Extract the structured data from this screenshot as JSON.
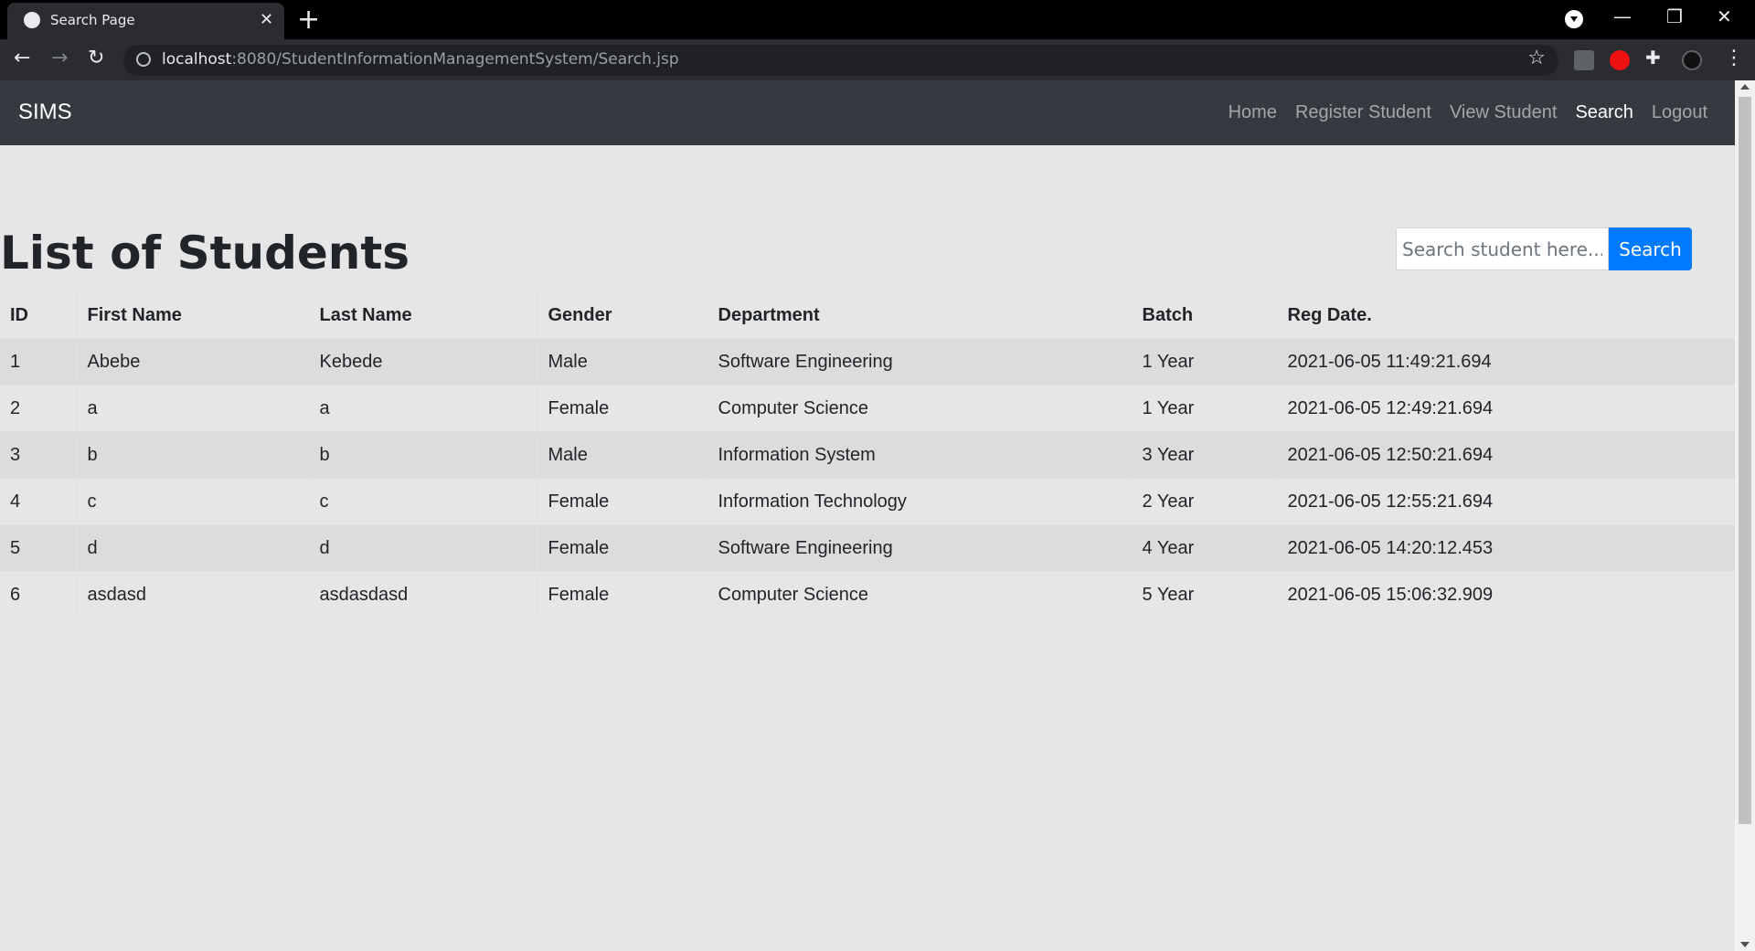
{
  "browser": {
    "tab_title": "Search Page",
    "new_tab_symbol": "+",
    "close_symbol": "✕",
    "url_host": "localhost",
    "url_rest": ":8080/StudentInformationManagementSystem/Search.jsp",
    "icons": [
      "globe-icon",
      "close-icon",
      "plus-icon",
      "back-icon",
      "forward-icon",
      "reload-icon",
      "info-icon",
      "star-icon",
      "extension-icon",
      "menu-icon"
    ]
  },
  "navbar": {
    "brand": "SIMS",
    "links": [
      "Home",
      "Register Student",
      "View Student",
      "Search",
      "Logout"
    ],
    "active": "Search"
  },
  "main": {
    "title": "List of Students",
    "search_placeholder": "Search student here...",
    "search_button": "Search"
  },
  "table": {
    "headers": [
      "ID",
      "First Name",
      "Last Name",
      "Gender",
      "Department",
      "Batch",
      "Reg Date."
    ],
    "rows": [
      [
        "1",
        "Abebe",
        "Kebede",
        "Male",
        "Software Engineering",
        "1 Year",
        "2021-06-05 11:49:21.694"
      ],
      [
        "2",
        "a",
        "a",
        "Female",
        "Computer Science",
        "1 Year",
        "2021-06-05 12:49:21.694"
      ],
      [
        "3",
        "b",
        "b",
        "Male",
        "Information System",
        "3 Year",
        "2021-06-05 12:50:21.694"
      ],
      [
        "4",
        "c",
        "c",
        "Female",
        "Information Technology",
        "2 Year",
        "2021-06-05 12:55:21.694"
      ],
      [
        "5",
        "d",
        "d",
        "Female",
        "Software Engineering",
        "4 Year",
        "2021-06-05 14:20:12.453"
      ],
      [
        "6",
        "asdasd",
        "asdasdasd",
        "Female",
        "Computer Science",
        "5 Year",
        "2021-06-05 15:06:32.909"
      ]
    ]
  },
  "colors": {
    "navbar_bg": "#343a40",
    "page_bg": "#e6e6e6",
    "primary": "#007bff"
  }
}
